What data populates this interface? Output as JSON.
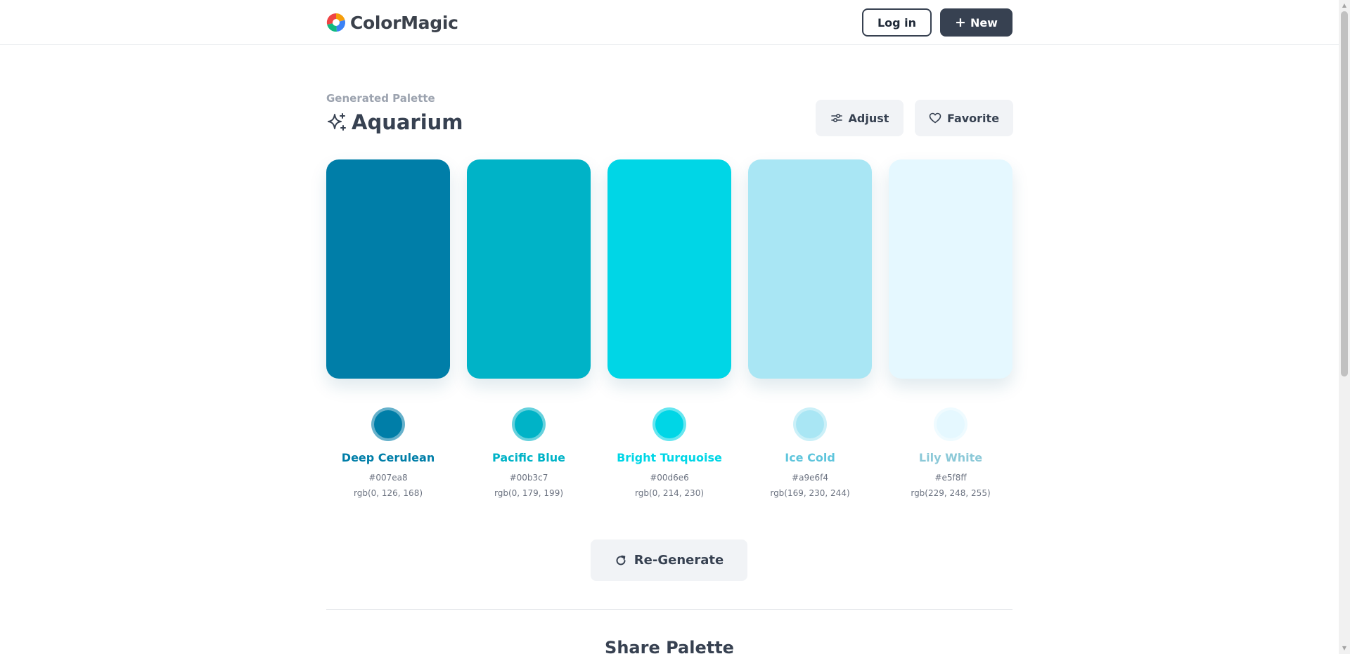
{
  "header": {
    "brand": "ColorMagic",
    "login_label": "Log in",
    "new_label": "New"
  },
  "palette": {
    "subtitle": "Generated Palette",
    "name": "Aquarium",
    "adjust_label": "Adjust",
    "favorite_label": "Favorite",
    "colors": [
      {
        "name": "Deep Cerulean",
        "hex": "#007ea8",
        "rgb": "rgb(0, 126, 168)"
      },
      {
        "name": "Pacific Blue",
        "hex": "#00b3c7",
        "rgb": "rgb(0, 179, 199)"
      },
      {
        "name": "Bright Turquoise",
        "hex": "#00d6e6",
        "rgb": "rgb(0, 214, 230)"
      },
      {
        "name": "Ice Cold",
        "hex": "#a9e6f4",
        "rgb": "rgb(169, 230, 244)"
      },
      {
        "name": "Lily White",
        "hex": "#e5f8ff",
        "rgb": "rgb(229, 248, 255)"
      }
    ],
    "name_colors": [
      "#007ea8",
      "#00b3c7",
      "#00d6e6",
      "#5fc5dc",
      "#8cc9d8"
    ],
    "regenerate_label": "Re-Generate"
  },
  "share": {
    "heading": "Share Palette"
  },
  "icons": {
    "logo": "colormagic-logo-icon",
    "plus": "plus-icon",
    "sparkle": "sparkle-icon",
    "adjust": "sliders-icon",
    "favorite": "heart-icon",
    "regenerate": "refresh-icon"
  }
}
